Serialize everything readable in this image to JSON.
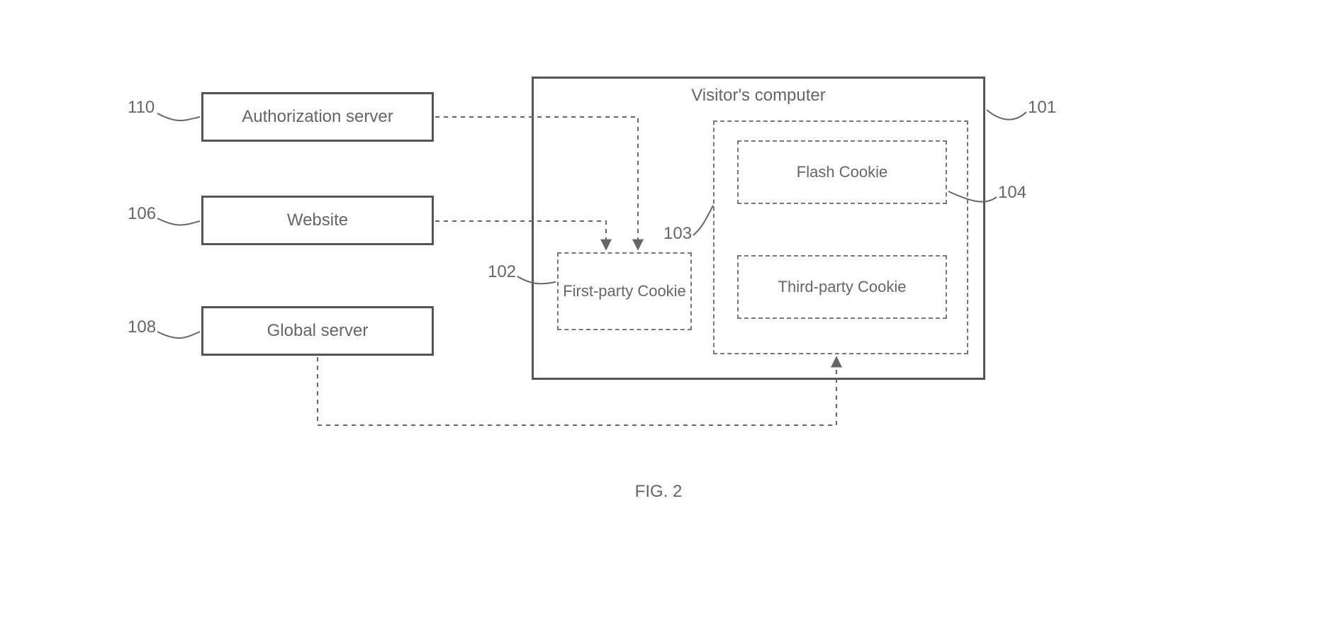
{
  "figure": {
    "caption": "FIG. 2",
    "refs": {
      "r110": "110",
      "r106": "106",
      "r108": "108",
      "r101": "101",
      "r102": "102",
      "r103": "103",
      "r104": "104"
    },
    "boxes": {
      "authorization_server": "Authorization server",
      "website": "Website",
      "global_server": "Global server",
      "visitors_computer_title": "Visitor's computer",
      "first_party_cookie": "First-party Cookie",
      "third_party_cookie": "Third-party Cookie",
      "flash_cookie": "Flash Cookie"
    }
  }
}
